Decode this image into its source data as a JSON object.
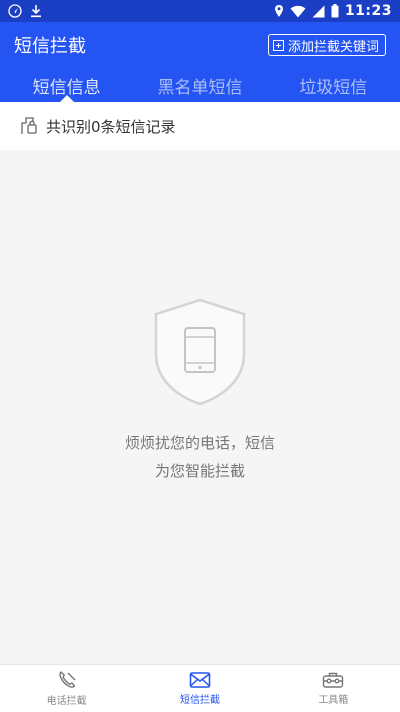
{
  "status_bar": {
    "time": "11:23"
  },
  "app_bar": {
    "title": "短信拦截",
    "add_keyword_label": "添加拦截关键词"
  },
  "tabs": [
    {
      "label": "短信信息",
      "active": true
    },
    {
      "label": "黑名单短信",
      "active": false
    },
    {
      "label": "垃圾短信",
      "active": false
    }
  ],
  "record_summary": "共识别0条短信记录",
  "empty_state": {
    "line1": "烦烦扰您的电话，短信",
    "line2": "为您智能拦截"
  },
  "bottom_nav": [
    {
      "label": "电话拦截",
      "icon": "phone-blocked-icon",
      "active": false
    },
    {
      "label": "短信拦截",
      "icon": "envelope-icon",
      "active": true
    },
    {
      "label": "工具箱",
      "icon": "toolbox-icon",
      "active": false
    }
  ],
  "colors": {
    "primary": "#2454f2",
    "status_bar": "#1b3fc4",
    "background": "#f5f5f5"
  }
}
